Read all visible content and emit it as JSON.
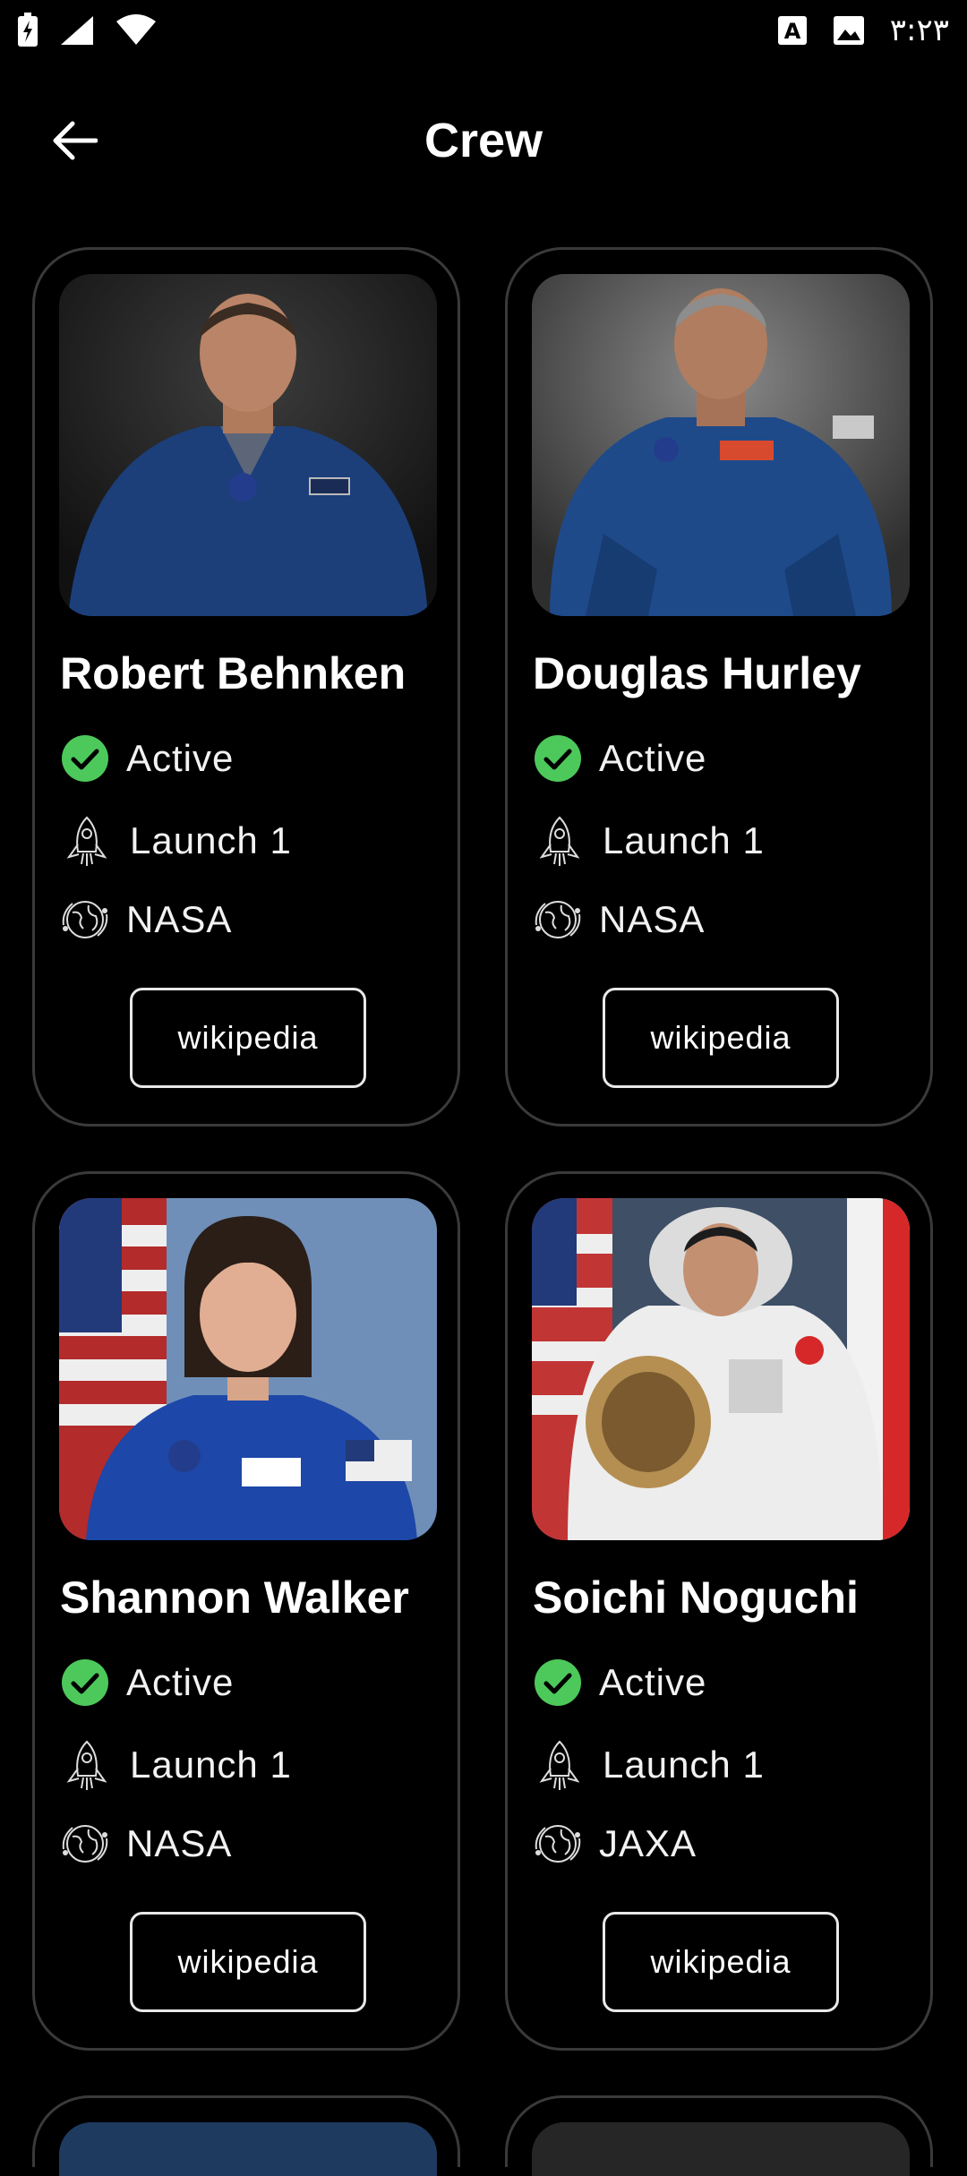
{
  "status_bar": {
    "time": "٣:٢٣",
    "icons": [
      "flash-icon",
      "signal-icon",
      "wifi-icon",
      "font-a-icon",
      "image-icon"
    ]
  },
  "app_bar": {
    "title": "Crew",
    "back_icon": "arrow-left-icon"
  },
  "crew": [
    {
      "name": "Robert Behnken",
      "status": "Active",
      "launch": "Launch 1",
      "agency": "NASA",
      "link_label": "wikipedia"
    },
    {
      "name": "Douglas Hurley",
      "status": "Active",
      "launch": "Launch 1",
      "agency": "NASA",
      "link_label": "wikipedia"
    },
    {
      "name": "Shannon Walker",
      "status": "Active",
      "launch": "Launch 1",
      "agency": "NASA",
      "link_label": "wikipedia"
    },
    {
      "name": "Soichi Noguchi",
      "status": "Active",
      "launch": "Launch 1",
      "agency": "JAXA",
      "link_label": "wikipedia"
    }
  ],
  "colors": {
    "background": "#000000",
    "card_border": "#3a3a3a",
    "active_green": "#4cc95a",
    "text": "#ffffff"
  }
}
